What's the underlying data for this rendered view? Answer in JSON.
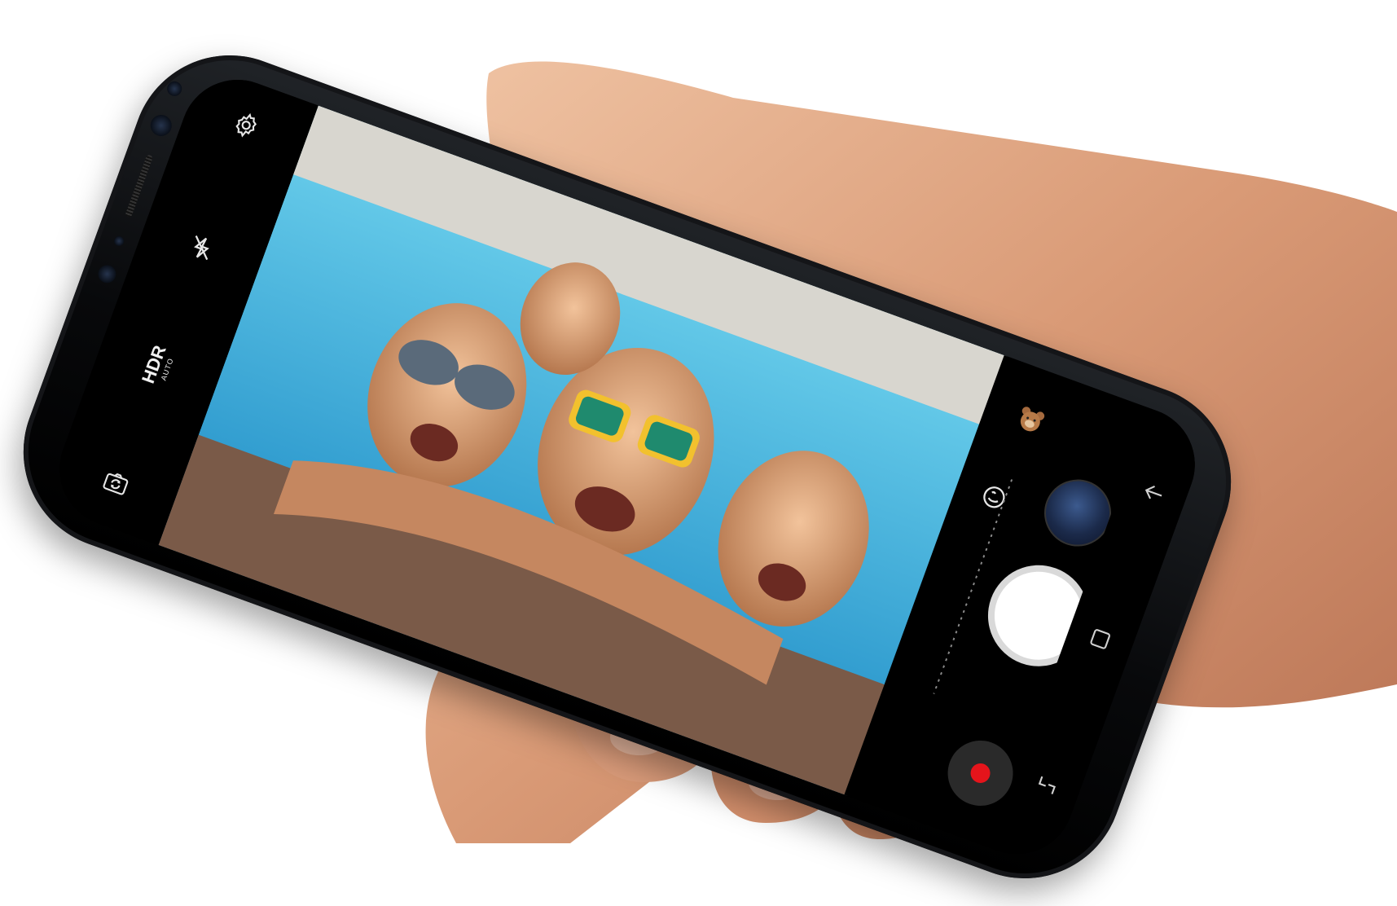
{
  "camera": {
    "hdr_label": "HDR",
    "hdr_sublabel": "AUTO",
    "icons": {
      "settings": "gear-icon",
      "flash": "flash-off-icon",
      "switch_camera": "switch-camera-icon",
      "sticker": "bear-sticker-icon",
      "bixby": "bixby-vision-icon",
      "gallery": "gallery-thumbnail",
      "shutter": "shutter-button",
      "record": "record-button"
    },
    "colors": {
      "record_dot": "#e5141b",
      "shutter": "#ffffff",
      "ui_background": "#000000"
    }
  },
  "navigation": {
    "icons": [
      "back-icon",
      "home-icon",
      "recent-apps-icon"
    ]
  }
}
